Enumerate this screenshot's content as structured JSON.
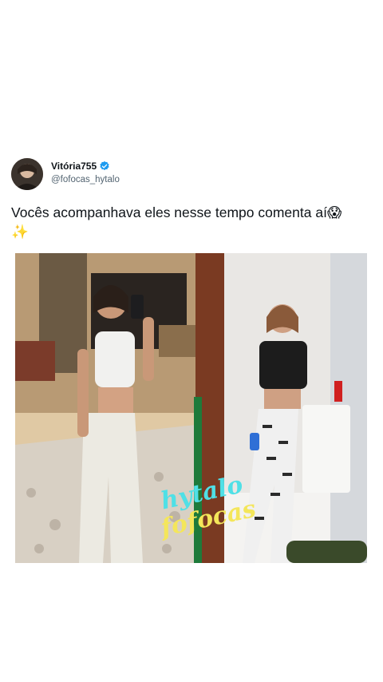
{
  "tweet": {
    "author_name": "Vitória755",
    "author_handle": "@fofocas_hytalo",
    "text_line1": "Vocês acompanhava eles nesse tempo comenta aí😱",
    "text_line2": "✨",
    "verified_color": "#1d9bf0"
  },
  "media": {
    "watermark_line1": "hytalo",
    "watermark_line2": "fofocas",
    "watermark_colors": [
      "#4fe0e6",
      "#f4e65a"
    ]
  },
  "icons": [
    "verified-badge-icon"
  ]
}
